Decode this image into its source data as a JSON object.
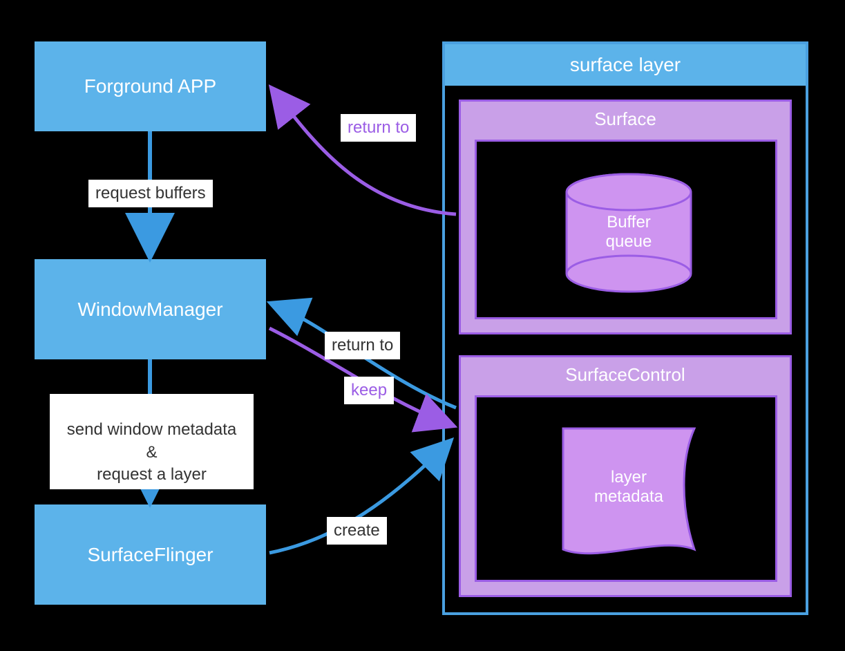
{
  "nodes": {
    "foreground_app": "Forground APP",
    "window_manager": "WindowManager",
    "surface_flinger": "SurfaceFlinger",
    "surface_layer": "surface layer",
    "surface": "Surface",
    "buffer_queue": "Buffer\nqueue",
    "surface_control": "SurfaceControl",
    "layer_metadata": "layer\nmetadata"
  },
  "edges": {
    "request_buffers": "request buffers",
    "send_window_metadata": "send window metadata\n&\nrequest a layer",
    "return_to_1": "return to",
    "return_to_2": "return to",
    "keep": "keep",
    "create": "create"
  },
  "colors": {
    "blue": "#5cb3ea",
    "blue_border": "#4aa0e0",
    "purple_light": "#c9a0e8",
    "purple_border": "#9b5de5",
    "purple_fill": "#ce94f0",
    "arrow_blue": "#3b9ae1",
    "arrow_purple": "#9b5de5"
  }
}
